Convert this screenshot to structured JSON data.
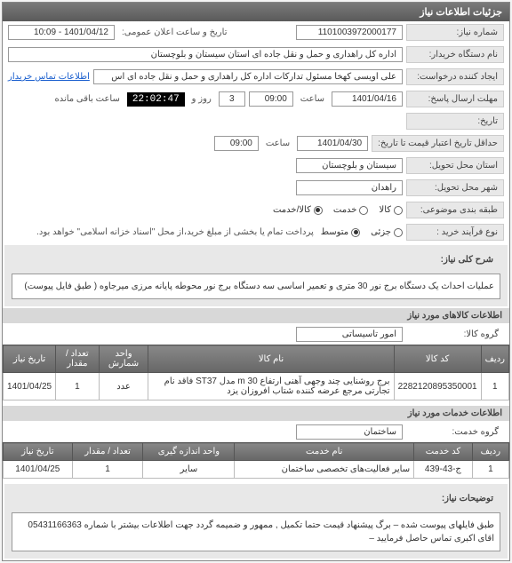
{
  "header": {
    "title": "جزئیات اطلاعات نیاز"
  },
  "form": {
    "need_number_label": "شماره نیاز:",
    "need_number": "1101003972000177",
    "announce_label": "تاریخ و ساعت اعلان عمومی:",
    "announce_value": "1401/04/12 - 10:09",
    "buyer_label": "نام دستگاه خریدار:",
    "buyer_value": "اداره کل راهداری و حمل و نقل جاده ای استان سیستان و بلوچستان",
    "creator_label": "ایجاد کننده درخواست:",
    "creator_value": "علی اویسی کهخا مسئول تدارکات اداره کل راهداری و حمل و نقل جاده ای اس",
    "contact_link": "اطلاعات تماس خریدار",
    "deadline_label": "مهلت ارسال پاسخ:",
    "deadline_date": "1401/04/16",
    "time_label": "ساعت",
    "deadline_time": "09:00",
    "day_label": "روز و",
    "days_remaining": "3",
    "timer": "22:02:47",
    "remaining_label": "ساعت باقی مانده",
    "history_label": "تاریخ:",
    "validity_label": "حداقل تاریخ اعتبار قیمت تا تاریخ:",
    "validity_date": "1401/04/30",
    "validity_time": "09:00",
    "province_label": "استان محل تحویل:",
    "province_value": "سیستان و بلوچستان",
    "city_label": "شهر محل تحویل:",
    "city_value": "راهدان",
    "budget_label": "طبقه بندی موضوعی:",
    "radio_goods": "کالا",
    "radio_service": "خدمت",
    "radio_both": "کالا/خدمت",
    "process_label": "نوع فرآیند خرید :",
    "radio_partial": "جزئی",
    "radio_medium": "متوسط",
    "payment_note": "پرداخت تمام یا بخشی از مبلغ خرید،از محل \"اسناد خزانه اسلامی\" خواهد بود.",
    "desc_label": "شرح کلی نیاز:",
    "desc_text": "عملیات احداث یک دستگاه برج نور 30 متری و تعمیر اساسی سه دستگاه برج نور محوطه پایانه مرزی میرجاوه ( طبق فایل پیوست)",
    "goods_section": "اطلاعات کالاهای مورد نیاز",
    "goods_group_label": "گروه کالا:",
    "goods_group_value": "امور تاسیساتی",
    "services_section": "اطلاعات خدمات مورد نیاز",
    "service_group_label": "گروه خدمت:",
    "service_group_value": "ساختمان",
    "notes_label": "توضیحات نیاز:",
    "notes_text": "طبق فایلهای پیوست شده – برگ پیشنهاد قیمت حتما تکمیل , ممهور و ضمیمه گردد جهت اطلاعات بیشتر با شماره 05431166363 اقای اکبری تماس حاصل فرمایید –"
  },
  "goods_table": {
    "headers": [
      "ردیف",
      "کد کالا",
      "نام کالا",
      "واحد شمارش",
      "تعداد / مقدار",
      "تاریخ نیاز"
    ],
    "rows": [
      {
        "idx": "1",
        "code": "2282120895350001",
        "name": "برج روشنایی چند وجهی آهنی ارتفاع 30 m مدل ST37 فاقد نام تجارتی مرجع عرضه کننده شتاب افروزان یزد",
        "unit": "عدد",
        "qty": "1",
        "date": "1401/04/25"
      }
    ]
  },
  "services_table": {
    "headers": [
      "ردیف",
      "کد خدمت",
      "نام خدمت",
      "واحد اندازه گیری",
      "تعداد / مقدار",
      "تاریخ نیاز"
    ],
    "rows": [
      {
        "idx": "1",
        "code": "ج-43-439",
        "name": "سایر فعالیت‌های تخصصی ساختمان",
        "unit": "سایر",
        "qty": "1",
        "date": "1401/04/25"
      }
    ]
  }
}
